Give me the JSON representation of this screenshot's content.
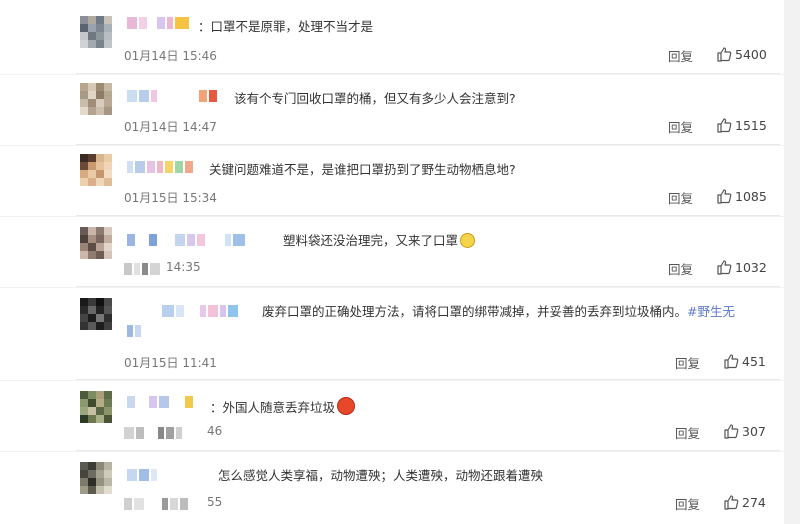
{
  "comments": [
    {
      "text": "：口罩不是原罪，处理不当才是",
      "time": "01月14日 15:46",
      "reply": "回复",
      "likes": "5400"
    },
    {
      "text": "该有个专门回收口罩的桶，但又有多少人会注意到?",
      "time": "01月14日 14:47",
      "reply": "回复",
      "likes": "1515"
    },
    {
      "text": "关键问题难道不是，是谁把口罩扔到了野生动物栖息地?",
      "time": "01月15日 15:34",
      "reply": "回复",
      "likes": "1085"
    },
    {
      "text": "塑料袋还没治理完，又来了口罩",
      "time": "14:35",
      "reply": "回复",
      "likes": "1032",
      "emoji": "😷"
    },
    {
      "text": "废弃口罩的正确处理方法，请将口罩的绑带减掉，并妥善的丢弃到垃圾桶内。",
      "hashtag": "#野生无",
      "time": "01月15日 11:41",
      "reply": "回复",
      "likes": "451"
    },
    {
      "text": "外国人随意丢弃垃圾",
      "time": "46",
      "reply": "回复",
      "likes": "307",
      "emoji": "😡"
    },
    {
      "text": "怎么感觉人类享福，动物遭殃；人类遭殃，动物还跟着遭殃",
      "time": "55",
      "reply": "回复",
      "likes": "274"
    }
  ],
  "colors": {
    "background": "#f2f2f2",
    "card": "#ffffff",
    "text": "#333333",
    "meta": "#777777",
    "hashtag": "#5c78c8"
  },
  "icons": {
    "like": "thumbs-up-icon"
  }
}
